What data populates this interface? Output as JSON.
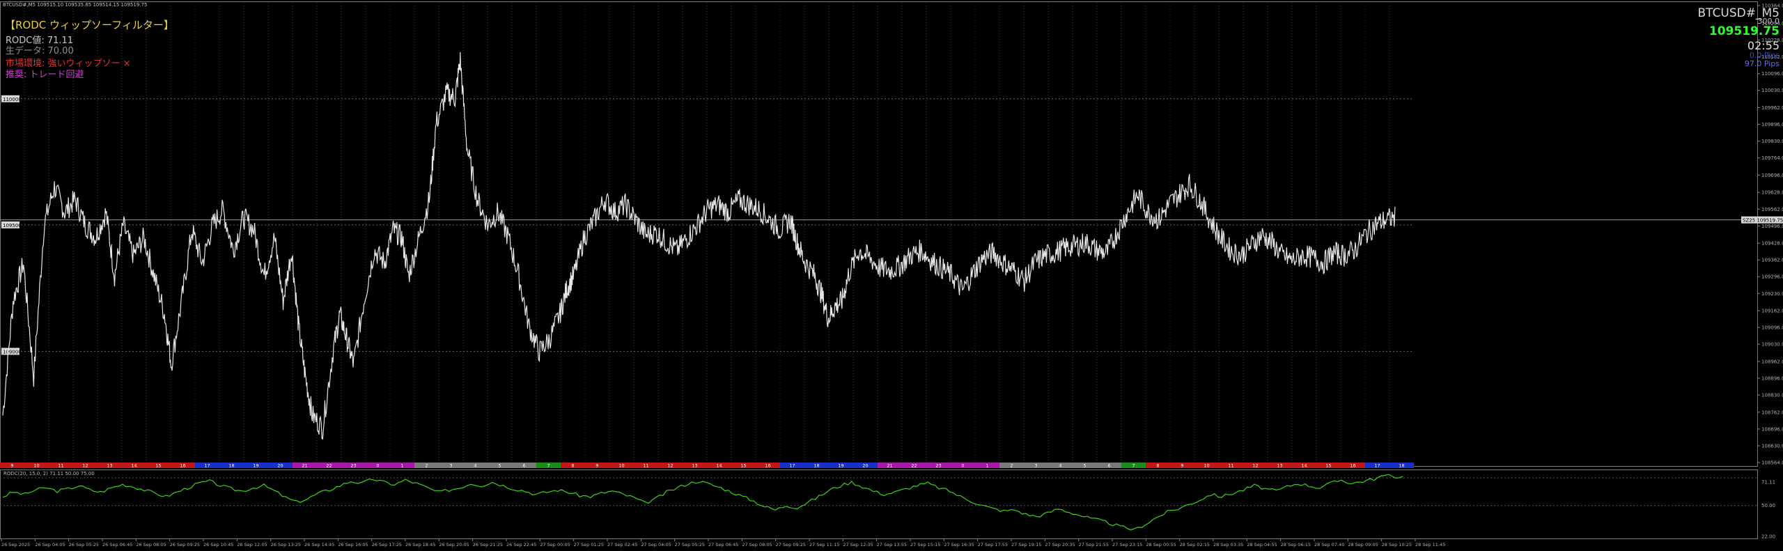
{
  "window": {
    "symbol_line": "BTCUSD#,M5  109515.10 109535.85 109514.15 109519.75"
  },
  "indicator": {
    "title": "【RODC ウィップソーフィルター】",
    "value_line": "RODC値: 71.11",
    "raw_line": "生データ: 70.00",
    "env_line": "市場環境: 強いウィップソー ×",
    "reco_line": "推奨: トレード回避",
    "colors": {
      "title": "#e8d13a",
      "value": "#c8c8c8",
      "raw": "#8f8f8f",
      "env": "#e03333",
      "reco": "#d040d0"
    }
  },
  "right_panel": {
    "symbol": "BTCUSD#_M5",
    "spread": "300.0",
    "bid": "109519.75",
    "timer": "02:55",
    "pips1": "0.0 Pips",
    "pips2": "97.0 Pips"
  },
  "price_axis": {
    "ticks": [
      "110364.00",
      "110294.00",
      "110228.00",
      "110162.00",
      "110096.00",
      "110030.00",
      "109962.00",
      "109896.00",
      "109830.00",
      "109764.00",
      "109696.00",
      "109628.00",
      "109562.00",
      "109496.00",
      "109428.00",
      "109362.00",
      "109296.00",
      "109230.00",
      "109162.00",
      "109096.00",
      "109030.00",
      "108962.00",
      "108896.00",
      "108830.00",
      "108762.00",
      "108696.00",
      "108630.00",
      "108564.00"
    ],
    "current_price": "109519.75",
    "current_tag": "SZ25"
  },
  "levels": [
    {
      "label": "110000",
      "price": 109997
    },
    {
      "label": "109500",
      "price": 109500
    },
    {
      "label": "109000",
      "price": 109002
    }
  ],
  "price_series": [
    [
      0,
      108750
    ],
    [
      0.6,
      109200
    ],
    [
      1.2,
      109350
    ],
    [
      1.8,
      108900
    ],
    [
      2.4,
      109500
    ],
    [
      3,
      109650
    ],
    [
      3.6,
      109550
    ],
    [
      4.2,
      109600
    ],
    [
      4.8,
      109500
    ],
    [
      5.4,
      109450
    ],
    [
      6,
      109550
    ],
    [
      6.5,
      109300
    ],
    [
      7,
      109500
    ],
    [
      7.6,
      109380
    ],
    [
      8.2,
      109450
    ],
    [
      8.8,
      109300
    ],
    [
      9.4,
      109150
    ],
    [
      9.8,
      108950
    ],
    [
      10.4,
      109200
    ],
    [
      11,
      109480
    ],
    [
      11.6,
      109350
    ],
    [
      12.2,
      109500
    ],
    [
      12.8,
      109560
    ],
    [
      13.4,
      109400
    ],
    [
      14,
      109530
    ],
    [
      14.6,
      109480
    ],
    [
      15.2,
      109300
    ],
    [
      15.8,
      109450
    ],
    [
      16.3,
      109200
    ],
    [
      16.8,
      109400
    ],
    [
      17.2,
      109100
    ],
    [
      17.6,
      108900
    ],
    [
      18,
      108750
    ],
    [
      18.6,
      108700
    ],
    [
      19.2,
      109000
    ],
    [
      19.6,
      109150
    ],
    [
      20,
      109050
    ],
    [
      20.4,
      108950
    ],
    [
      21,
      109200
    ],
    [
      21.6,
      109400
    ],
    [
      22.2,
      109350
    ],
    [
      22.7,
      109480
    ],
    [
      23.2,
      109450
    ],
    [
      23.6,
      109300
    ],
    [
      24.2,
      109450
    ],
    [
      24.8,
      109600
    ],
    [
      25.2,
      109900
    ],
    [
      25.8,
      110020
    ],
    [
      26.3,
      110000
    ],
    [
      26.6,
      110150
    ],
    [
      27,
      109800
    ],
    [
      27.6,
      109600
    ],
    [
      28.2,
      109500
    ],
    [
      28.8,
      109550
    ],
    [
      29.4,
      109450
    ],
    [
      30,
      109300
    ],
    [
      30.6,
      109100
    ],
    [
      31.2,
      109000
    ],
    [
      31.8,
      109050
    ],
    [
      32.4,
      109150
    ],
    [
      32.8,
      109250
    ],
    [
      33.2,
      109300
    ],
    [
      33.8,
      109450
    ],
    [
      34.4,
      109520
    ],
    [
      35,
      109600
    ],
    [
      35.6,
      109550
    ],
    [
      36.2,
      109580
    ],
    [
      36.8,
      109520
    ],
    [
      37.4,
      109460
    ],
    [
      38,
      109470
    ],
    [
      38.6,
      109430
    ],
    [
      39.2,
      109400
    ],
    [
      39.8,
      109450
    ],
    [
      40.4,
      109500
    ],
    [
      41,
      109560
    ],
    [
      41.6,
      109580
    ],
    [
      42.2,
      109550
    ],
    [
      42.8,
      109600
    ],
    [
      43.4,
      109580
    ],
    [
      44,
      109560
    ],
    [
      44.6,
      109520
    ],
    [
      45.2,
      109480
    ],
    [
      45.8,
      109520
    ],
    [
      46.2,
      109430
    ],
    [
      46.6,
      109360
    ],
    [
      47.2,
      109300
    ],
    [
      47.6,
      109230
    ],
    [
      48,
      109130
    ],
    [
      48.4,
      109180
    ],
    [
      48.8,
      109200
    ],
    [
      49.2,
      109310
    ],
    [
      49.8,
      109400
    ],
    [
      50.4,
      109370
    ],
    [
      51,
      109330
    ],
    [
      51.6,
      109320
    ],
    [
      52.2,
      109340
    ],
    [
      52.8,
      109380
    ],
    [
      53.4,
      109400
    ],
    [
      54,
      109360
    ],
    [
      54.6,
      109330
    ],
    [
      55.2,
      109300
    ],
    [
      55.8,
      109240
    ],
    [
      56.4,
      109310
    ],
    [
      57,
      109370
    ],
    [
      57.6,
      109390
    ],
    [
      58.2,
      109350
    ],
    [
      58.8,
      109320
    ],
    [
      59.4,
      109280
    ],
    [
      60,
      109350
    ],
    [
      60.6,
      109380
    ],
    [
      61.2,
      109390
    ],
    [
      61.8,
      109410
    ],
    [
      62.4,
      109420
    ],
    [
      63,
      109430
    ],
    [
      63.6,
      109400
    ],
    [
      64.2,
      109390
    ],
    [
      64.8,
      109470
    ],
    [
      65.4,
      109550
    ],
    [
      66,
      109620
    ],
    [
      66.6,
      109550
    ],
    [
      67.2,
      109520
    ],
    [
      67.8,
      109580
    ],
    [
      68.4,
      109620
    ],
    [
      69,
      109660
    ],
    [
      69.6,
      109600
    ],
    [
      70.2,
      109520
    ],
    [
      70.8,
      109450
    ],
    [
      71.4,
      109400
    ],
    [
      72,
      109380
    ],
    [
      72.6,
      109420
    ],
    [
      73.2,
      109460
    ],
    [
      73.8,
      109430
    ],
    [
      74.4,
      109380
    ],
    [
      75,
      109360
    ],
    [
      75.6,
      109380
    ],
    [
      76.2,
      109370
    ],
    [
      76.8,
      109350
    ],
    [
      77.4,
      109390
    ],
    [
      78,
      109380
    ],
    [
      78.6,
      109400
    ],
    [
      79.2,
      109460
    ],
    [
      79.8,
      109500
    ],
    [
      80.4,
      109520
    ],
    [
      81,
      109530
    ]
  ],
  "hour_strip": [
    {
      "label": "9",
      "color": "#c01818"
    },
    {
      "label": "10",
      "color": "#c01818"
    },
    {
      "label": "11",
      "color": "#c01818"
    },
    {
      "label": "12",
      "color": "#c01818"
    },
    {
      "label": "13",
      "color": "#c01818"
    },
    {
      "label": "14",
      "color": "#c01818"
    },
    {
      "label": "15",
      "color": "#c01818"
    },
    {
      "label": "16",
      "color": "#c01818"
    },
    {
      "label": "17",
      "color": "#1830c8"
    },
    {
      "label": "18",
      "color": "#1830c8"
    },
    {
      "label": "19",
      "color": "#1830c8"
    },
    {
      "label": "20",
      "color": "#1830c8"
    },
    {
      "label": "21",
      "color": "#a818a8"
    },
    {
      "label": "22",
      "color": "#a818a8"
    },
    {
      "label": "23",
      "color": "#a818a8"
    },
    {
      "label": "0",
      "color": "#a818a8"
    },
    {
      "label": "1",
      "color": "#a818a8"
    },
    {
      "label": "2",
      "color": "#787878"
    },
    {
      "label": "3",
      "color": "#787878"
    },
    {
      "label": "4",
      "color": "#787878"
    },
    {
      "label": "5",
      "color": "#787878"
    },
    {
      "label": "6",
      "color": "#787878"
    },
    {
      "label": "7",
      "color": "#1a8c1a"
    },
    {
      "label": "8",
      "color": "#c01818"
    },
    {
      "label": "9",
      "color": "#c01818"
    },
    {
      "label": "10",
      "color": "#c01818"
    },
    {
      "label": "11",
      "color": "#c01818"
    },
    {
      "label": "12",
      "color": "#c01818"
    },
    {
      "label": "13",
      "color": "#c01818"
    },
    {
      "label": "14",
      "color": "#c01818"
    },
    {
      "label": "15",
      "color": "#c01818"
    },
    {
      "label": "16",
      "color": "#c01818"
    },
    {
      "label": "17",
      "color": "#1830c8"
    },
    {
      "label": "18",
      "color": "#1830c8"
    },
    {
      "label": "19",
      "color": "#1830c8"
    },
    {
      "label": "20",
      "color": "#1830c8"
    },
    {
      "label": "21",
      "color": "#a818a8"
    },
    {
      "label": "22",
      "color": "#a818a8"
    },
    {
      "label": "23",
      "color": "#a818a8"
    },
    {
      "label": "0",
      "color": "#a818a8"
    },
    {
      "label": "1",
      "color": "#a818a8"
    },
    {
      "label": "2",
      "color": "#787878"
    },
    {
      "label": "3",
      "color": "#787878"
    },
    {
      "label": "4",
      "color": "#787878"
    },
    {
      "label": "5",
      "color": "#787878"
    },
    {
      "label": "6",
      "color": "#787878"
    },
    {
      "label": "7",
      "color": "#1a8c1a"
    },
    {
      "label": "8",
      "color": "#c01818"
    },
    {
      "label": "9",
      "color": "#c01818"
    },
    {
      "label": "10",
      "color": "#c01818"
    },
    {
      "label": "11",
      "color": "#c01818"
    },
    {
      "label": "12",
      "color": "#c01818"
    },
    {
      "label": "13",
      "color": "#c01818"
    },
    {
      "label": "14",
      "color": "#c01818"
    },
    {
      "label": "15",
      "color": "#c01818"
    },
    {
      "label": "16",
      "color": "#c01818"
    },
    {
      "label": "17",
      "color": "#1830c8"
    },
    {
      "label": "18",
      "color": "#1830c8"
    }
  ],
  "rodc": {
    "label": "RODC(20, 15.0, 2) 71.11 50.00 75.00",
    "axis_ticks": [
      "71.11",
      "50.00",
      "22.00"
    ],
    "levels": [
      75,
      50
    ],
    "ylim": [
      22,
      80
    ],
    "color": "#39d511",
    "values": [
      58,
      62,
      60,
      64,
      66,
      63,
      65,
      68,
      64,
      62,
      66,
      69,
      67,
      64,
      61,
      58,
      62,
      66,
      70,
      72,
      68,
      65,
      63,
      66,
      68,
      63,
      57,
      53,
      56,
      61,
      64,
      68,
      72,
      70,
      74,
      71,
      69,
      73,
      70,
      66,
      62,
      64,
      66,
      70,
      68,
      71,
      68,
      65,
      63,
      60,
      62,
      64,
      62,
      59,
      58,
      61,
      63,
      60,
      57,
      52,
      56,
      62,
      66,
      70,
      72,
      69,
      66,
      62,
      58,
      54,
      49,
      46,
      50,
      48,
      53,
      58,
      64,
      68,
      71,
      67,
      63,
      60,
      62,
      65,
      68,
      70,
      66,
      63,
      58,
      54,
      50,
      47,
      45,
      46,
      42,
      40,
      43,
      47,
      44,
      41,
      38,
      36,
      33,
      30,
      28,
      33,
      39,
      44,
      47,
      51,
      55,
      60,
      58,
      61,
      64,
      68,
      65,
      63,
      67,
      70,
      68,
      66,
      70,
      73,
      70,
      72,
      74,
      77,
      76
    ]
  },
  "time_axis": [
    "26 Sep 2025",
    "26 Sep 04:05",
    "26 Sep 05:25",
    "26 Sep 06:45",
    "26 Sep 08:05",
    "26 Sep 09:25",
    "26 Sep 10:45",
    "26 Sep 12:05",
    "26 Sep 13:25",
    "26 Sep 14:45",
    "26 Sep 16:05",
    "26 Sep 17:25",
    "26 Sep 18:45",
    "26 Sep 20:05",
    "26 Sep 21:25",
    "26 Sep 22:45",
    "27 Sep 00:05",
    "27 Sep 01:25",
    "27 Sep 02:45",
    "27 Sep 04:05",
    "27 Sep 05:25",
    "27 Sep 06:45",
    "27 Sep 08:05",
    "27 Sep 09:25",
    "27 Sep 11:15",
    "27 Sep 12:35",
    "27 Sep 13:55",
    "27 Sep 15:15",
    "27 Sep 16:35",
    "27 Sep 17:55",
    "27 Sep 19:15",
    "27 Sep 20:35",
    "27 Sep 21:55",
    "27 Sep 23:15",
    "28 Sep 00:55",
    "28 Sep 02:15",
    "28 Sep 03:35",
    "28 Sep 04:55",
    "28 Sep 06:15",
    "28 Sep 07:40",
    "28 Sep 09:05",
    "28 Sep 10:25",
    "28 Sep 11:45"
  ]
}
